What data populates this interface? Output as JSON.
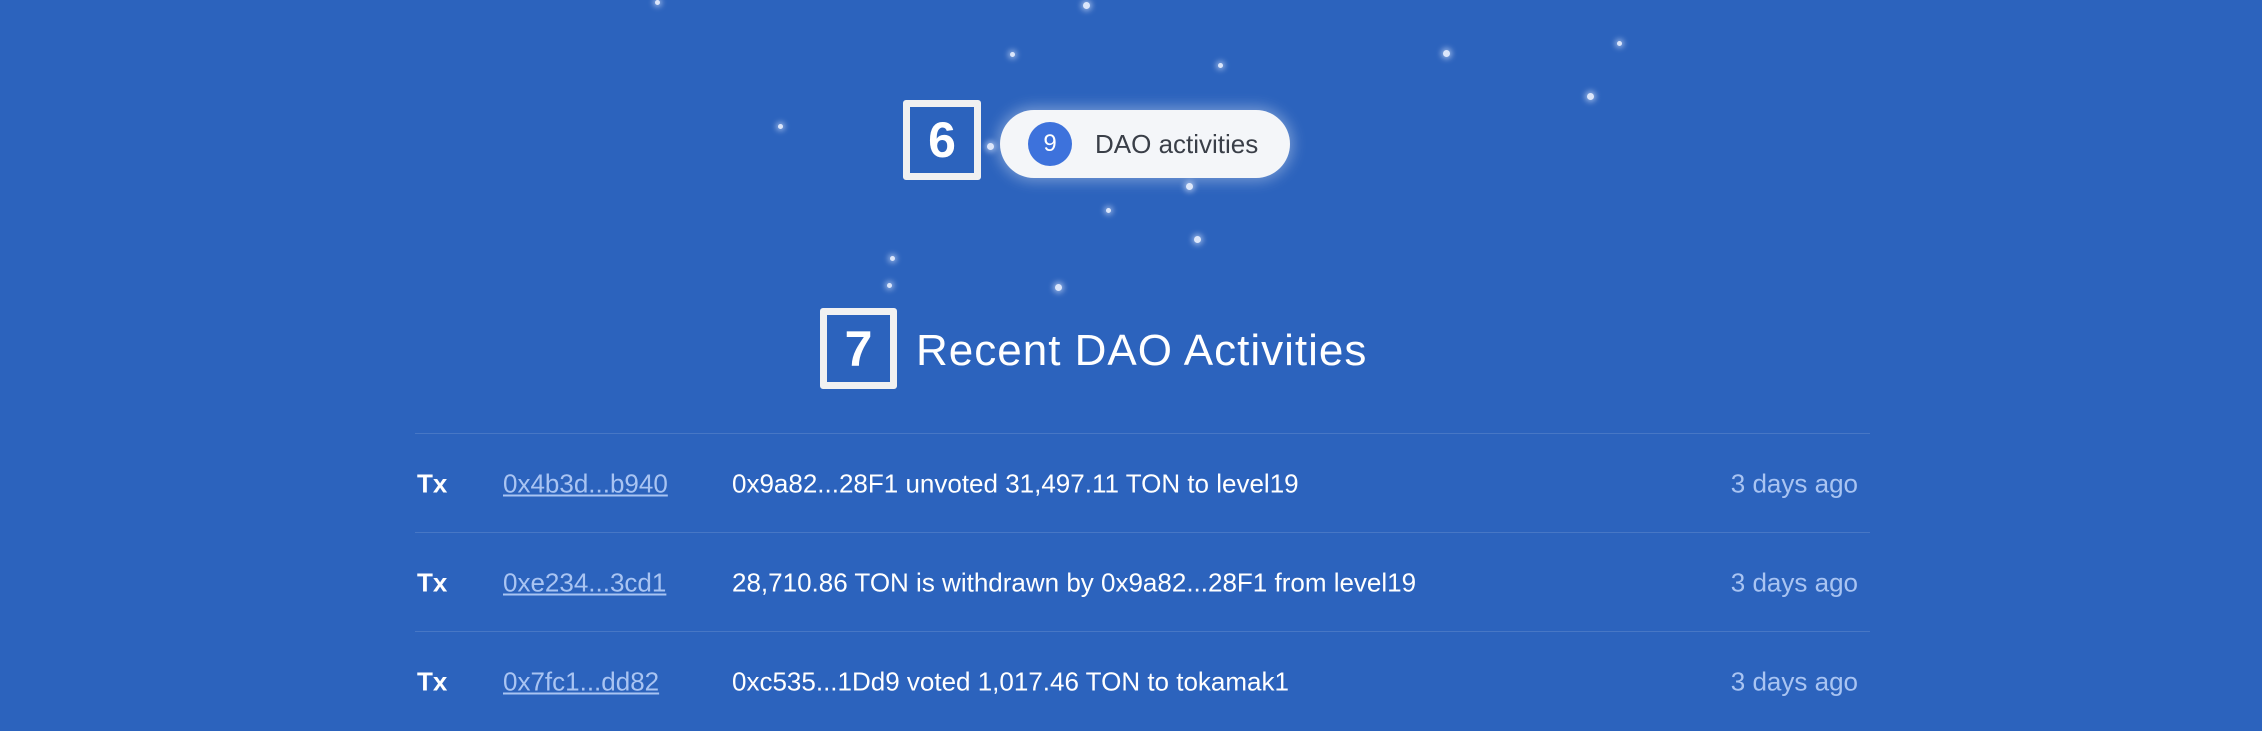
{
  "markers": {
    "badge": "6",
    "heading": "7"
  },
  "badge": {
    "count": "9",
    "label": "DAO activities"
  },
  "section_title": "Recent DAO Activities",
  "activities": [
    {
      "type": "Tx",
      "hash": "0x4b3d...b940",
      "description": "0x9a82...28F1 unvoted 31,497.11 TON to level19",
      "time": "3 days ago"
    },
    {
      "type": "Tx",
      "hash": "0xe234...3cd1",
      "description": "28,710.86 TON is withdrawn by 0x9a82...28F1 from level19",
      "time": "3 days ago"
    },
    {
      "type": "Tx",
      "hash": "0x7fc1...dd82",
      "description": "0xc535...1Dd9 voted 1,017.46 TON to tokamak1",
      "time": "3 days ago"
    }
  ],
  "colors": {
    "background": "#2c63bd",
    "accent": "#3d72dc",
    "link": "#a9c4f2"
  }
}
